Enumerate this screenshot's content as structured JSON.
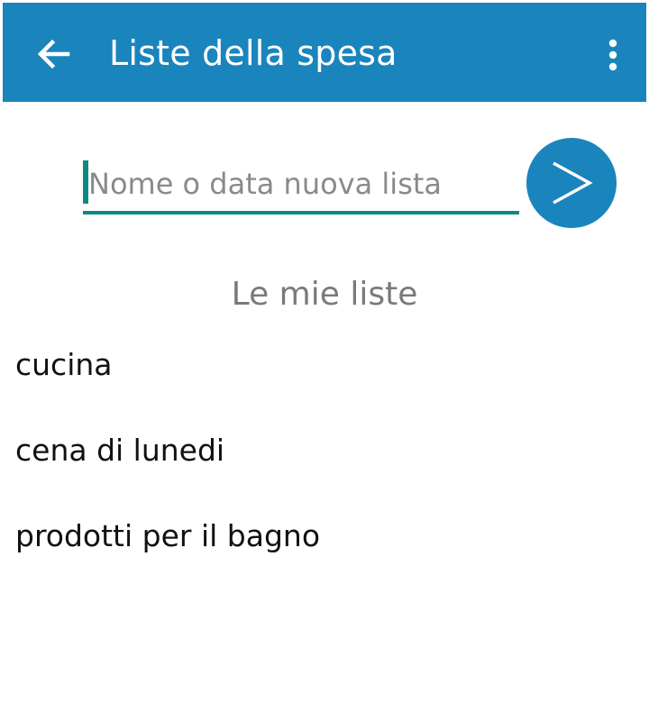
{
  "appbar": {
    "title": "Liste della spesa",
    "back_icon": "arrow-left-icon",
    "menu_icon": "more-vert-icon",
    "color": "#1a84bd"
  },
  "new_list": {
    "placeholder": "Nome o data nuova lista",
    "value": "",
    "submit_icon": "chevron-right-icon",
    "accent": "#0b8a80"
  },
  "section": {
    "title": "Le mie liste"
  },
  "lists": [
    {
      "label": "cucina"
    },
    {
      "label": "cena di lunedi"
    },
    {
      "label": "prodotti per il bagno"
    }
  ]
}
